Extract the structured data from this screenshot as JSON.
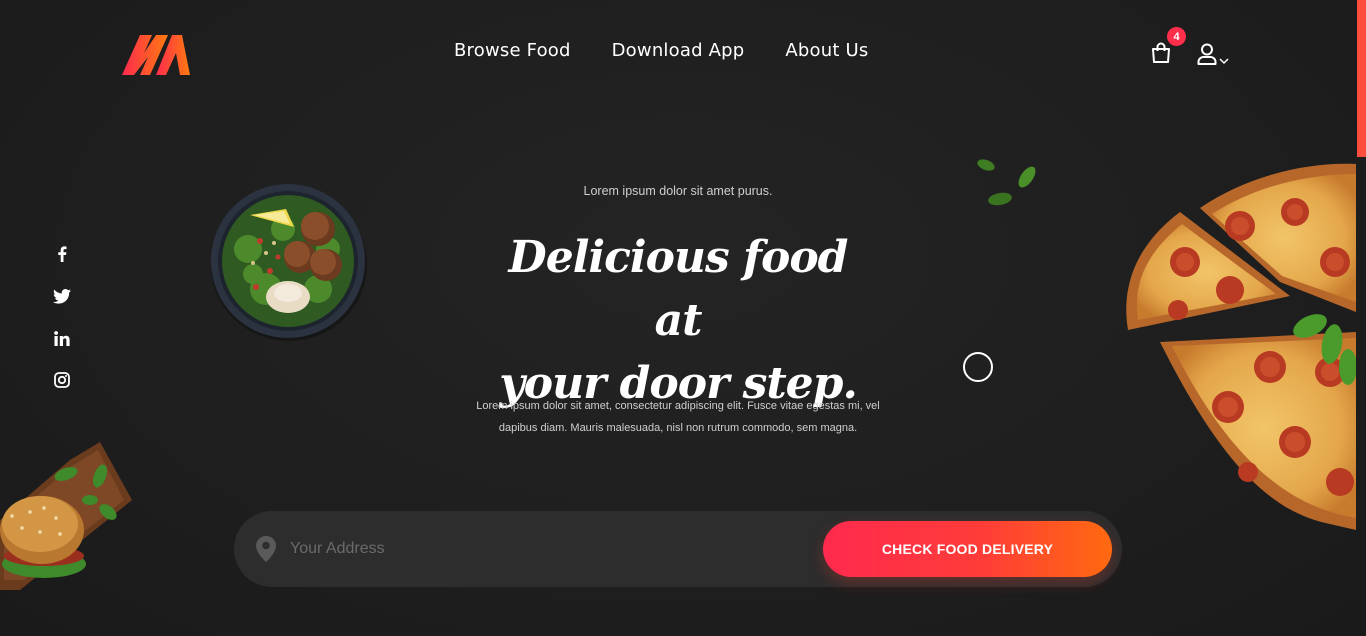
{
  "nav": {
    "items": [
      "Browse Food",
      "Download App",
      "About Us"
    ]
  },
  "cart": {
    "count": "4"
  },
  "hero": {
    "kicker": "Lorem ipsum dolor sit amet purus.",
    "headline_line1": "Delicious food at",
    "headline_line2": "your door step.",
    "description": "Lorem ipsum dolor sit amet, consectetur adipiscing elit. Fusce vitae egestas mi, vel dapibus diam. Mauris malesuada, nisl non rutrum commodo, sem magna."
  },
  "search": {
    "placeholder": "Your Address",
    "button_label": "CHECK FOOD DELIVERY"
  },
  "social": [
    "facebook-icon",
    "twitter-icon",
    "linkedin-icon",
    "instagram-icon"
  ],
  "colors": {
    "background": "#1f1f1f",
    "accent_start": "#ff2a4e",
    "accent_end": "#ff6a10",
    "badge": "#ff2e4a"
  }
}
